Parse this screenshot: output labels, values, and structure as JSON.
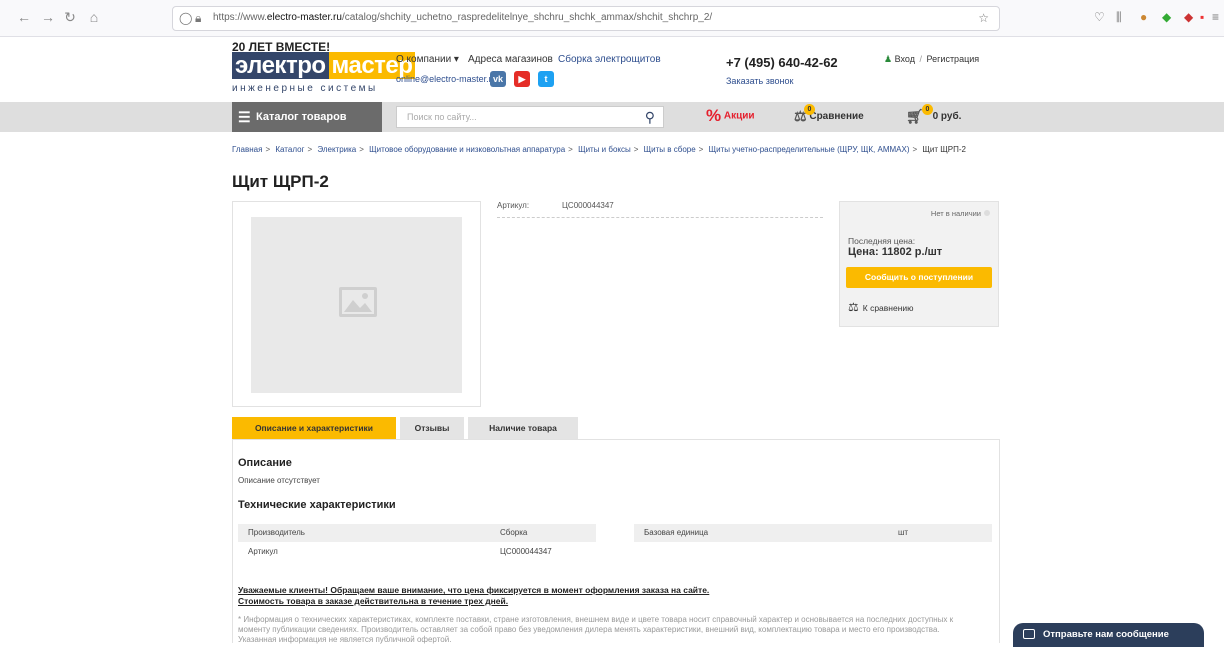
{
  "browser": {
    "url_prefix": "https://www.",
    "url_host": "electro-master.ru",
    "url_path": "/catalog/shchity_uchetno_raspredelitelnye_shchru_shchk_ammax/shchit_shchrp_2/"
  },
  "header": {
    "logo_tagline": "20 ЛЕТ ВМЕСТЕ!",
    "logo_part1": "электро",
    "logo_part2": "мастер",
    "logo_sub": "инженерные системы",
    "nav": [
      "О компании ▾",
      "Адреса магазинов",
      "Сборка электрощитов"
    ],
    "email": "online@electro-master.ru",
    "phone": "+7 (495) 640-42-62",
    "callback": "Заказать звонок",
    "login": "Вход",
    "login_sep": "/",
    "register": "Регистрация"
  },
  "toolbar": {
    "catalog": "Каталог товаров",
    "search_placeholder": "Поиск по сайту...",
    "promo": "Акции",
    "compare": "Сравнение",
    "compare_count": "0",
    "cart_count": "0",
    "cart_total": "0 руб."
  },
  "breadcrumbs": [
    "Главная",
    "Каталог",
    "Электрика",
    "Щитовое оборудование и низковольтная аппаратура",
    "Щиты и боксы",
    "Щиты в сборе",
    "Щиты учетно-распределительные (ЩРУ, ЩК, AMMAX)",
    "Щит ЩРП-2"
  ],
  "product": {
    "title": "Щит ЩРП-2",
    "article_label": "Артикул:",
    "article_value": "ЦС000044347",
    "stock": "Нет в наличии",
    "last_price_label": "Последняя цена:",
    "price": "Цена: 11802 р./шт",
    "notify_button": "Сообщить о поступлении",
    "compare_link": "К сравнению"
  },
  "tabs": [
    "Описание и характеристики",
    "Отзывы",
    "Наличие товара"
  ],
  "description": {
    "heading": "Описание",
    "text": "Описание отсутствует",
    "spec_heading": "Технические характеристики"
  },
  "specs": [
    {
      "name": "Производитель",
      "value": "Сборка"
    },
    {
      "name": "Артикул",
      "value": "ЦС000044347"
    },
    {
      "name": "Базовая единица",
      "value": "шт"
    }
  ],
  "notice": {
    "line1": "Уважаемые клиенты! Обращаем ваше внимание, что цена фиксируется в момент оформления заказа на сайте.",
    "line2": "Стоимость товара в заказе действительна в течение трех дней.",
    "fine": "* Информация о технических характеристиках, комплекте поставки, стране изготовления, внешнем виде и цвете товара носит справочный характер и основывается на последних доступных к моменту публикации сведениях. Производитель оставляет за собой право без уведомления дилера менять характеристики, внешний вид, комплектацию товара и место его производства. Указанная информация не является публичной офертой."
  },
  "chat": "Отправьте нам сообщение",
  "colors": {
    "brand_blue": "#34466a",
    "brand_yellow": "#fbba00",
    "promo_red": "#e5202e"
  }
}
